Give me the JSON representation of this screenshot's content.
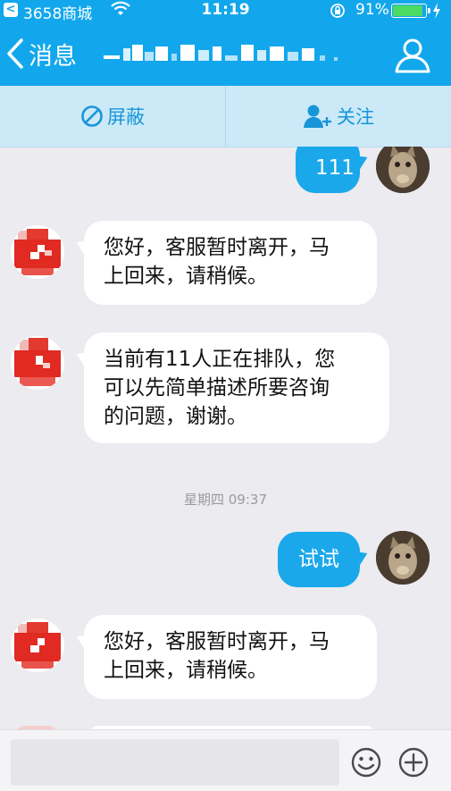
{
  "status_bar": {
    "back_app_glyph": "<",
    "carrier": "3658商城",
    "time": "11:19",
    "battery_percent": "91%",
    "battery_level": 0.91
  },
  "nav": {
    "back_label": "消息",
    "title": "",
    "profile_icon": "user-icon"
  },
  "actions": {
    "block_label": "屏蔽",
    "follow_label": "关注"
  },
  "messages": [
    {
      "side": "right",
      "text": "111",
      "avatar": "cat"
    },
    {
      "side": "left",
      "lines": [
        "您好，客服暂时离开，马",
        "上回来，请稍候。"
      ],
      "avatar": "red-logo"
    },
    {
      "side": "left",
      "lines": [
        "当前有11人正在排队，您",
        "可以先简单描述所要咨询",
        "的问题，谢谢。"
      ],
      "avatar": "red-logo"
    },
    {
      "type": "timestamp",
      "text": "星期四 09:37"
    },
    {
      "side": "right",
      "text": "试试",
      "avatar": "cat"
    },
    {
      "side": "left",
      "lines": [
        "您好，客服暂时离开，马",
        "上回来，请稍候。"
      ],
      "avatar": "red-logo"
    }
  ],
  "input": {
    "placeholder": "",
    "emoji_icon": "emoji-icon",
    "plus_icon": "plus-icon"
  },
  "colors": {
    "brand_blue": "#12a7ec",
    "bubble_blue": "#1aa8ea",
    "action_bg": "#cce9f8",
    "battery_green": "#4cd964"
  }
}
